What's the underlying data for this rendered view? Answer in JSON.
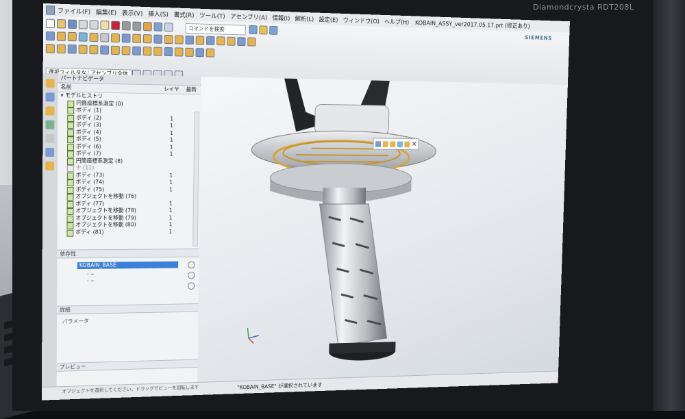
{
  "monitor": {
    "brand": "Diamondcrysta RDT208L"
  },
  "window": {
    "title": "KOBAIN_ASSY_ver2017.05.17.prt (修正あり)",
    "menu": [
      "ファイル(F)",
      "編集(E)",
      "表示(V)",
      "挿入(S)",
      "書式(R)",
      "ツール(T)",
      "アセンブリ(A)",
      "情報(I)",
      "解析(L)",
      "設定(E)",
      "ウィンドウ(O)",
      "ヘルプ(H)"
    ],
    "search_placeholder": "コマンドを検索",
    "vendor": "SIEMENS"
  },
  "selection_bar": {
    "filter": "選択フィルタなし",
    "scope": "アセンブリ全体"
  },
  "navigator": {
    "title": "パートナビゲータ",
    "columns": [
      "名前",
      "レイヤ",
      "最新"
    ],
    "root": "モデルヒストリ",
    "items": [
      {
        "label": "円筒座標系測定 (0)",
        "layer": ""
      },
      {
        "label": "ボディ (1)",
        "layer": ""
      },
      {
        "label": "ボディ (2)",
        "layer": "1"
      },
      {
        "label": "ボディ (3)",
        "layer": "1"
      },
      {
        "label": "ボディ (4)",
        "layer": "1"
      },
      {
        "label": "ボディ (5)",
        "layer": "1"
      },
      {
        "label": "ボディ (6)",
        "layer": "1"
      },
      {
        "label": "ボディ (7)",
        "layer": "1"
      },
      {
        "label": "円筒座標系測定 (8)",
        "layer": ""
      },
      {
        "label": "十 (11)",
        "layer": ""
      },
      {
        "label": "ボディ (73)",
        "layer": "1"
      },
      {
        "label": "ボディ (74)",
        "layer": "1"
      },
      {
        "label": "ボディ (75)",
        "layer": "1"
      },
      {
        "label": "オブジェクトを移動 (76)",
        "layer": ""
      },
      {
        "label": "ボディ (77)",
        "layer": "1"
      },
      {
        "label": "オブジェクトを移動 (78)",
        "layer": "1"
      },
      {
        "label": "オブジェクトを移動 (79)",
        "layer": "1"
      },
      {
        "label": "オブジェクトを移動 (80)",
        "layer": "1"
      },
      {
        "label": "ボディ (81)",
        "layer": "1"
      }
    ],
    "dependency_label": "依存性",
    "dependency_selected": "KOBAIN_BASE",
    "detail_label": "詳細",
    "param_label": "パラメータ",
    "preview_label": "プレビュー"
  },
  "status": {
    "message": "\"KOBAIN_BASE\" が選択されています",
    "cue": "オブジェクトを選択してください。ドラッグでビューを回転します"
  }
}
